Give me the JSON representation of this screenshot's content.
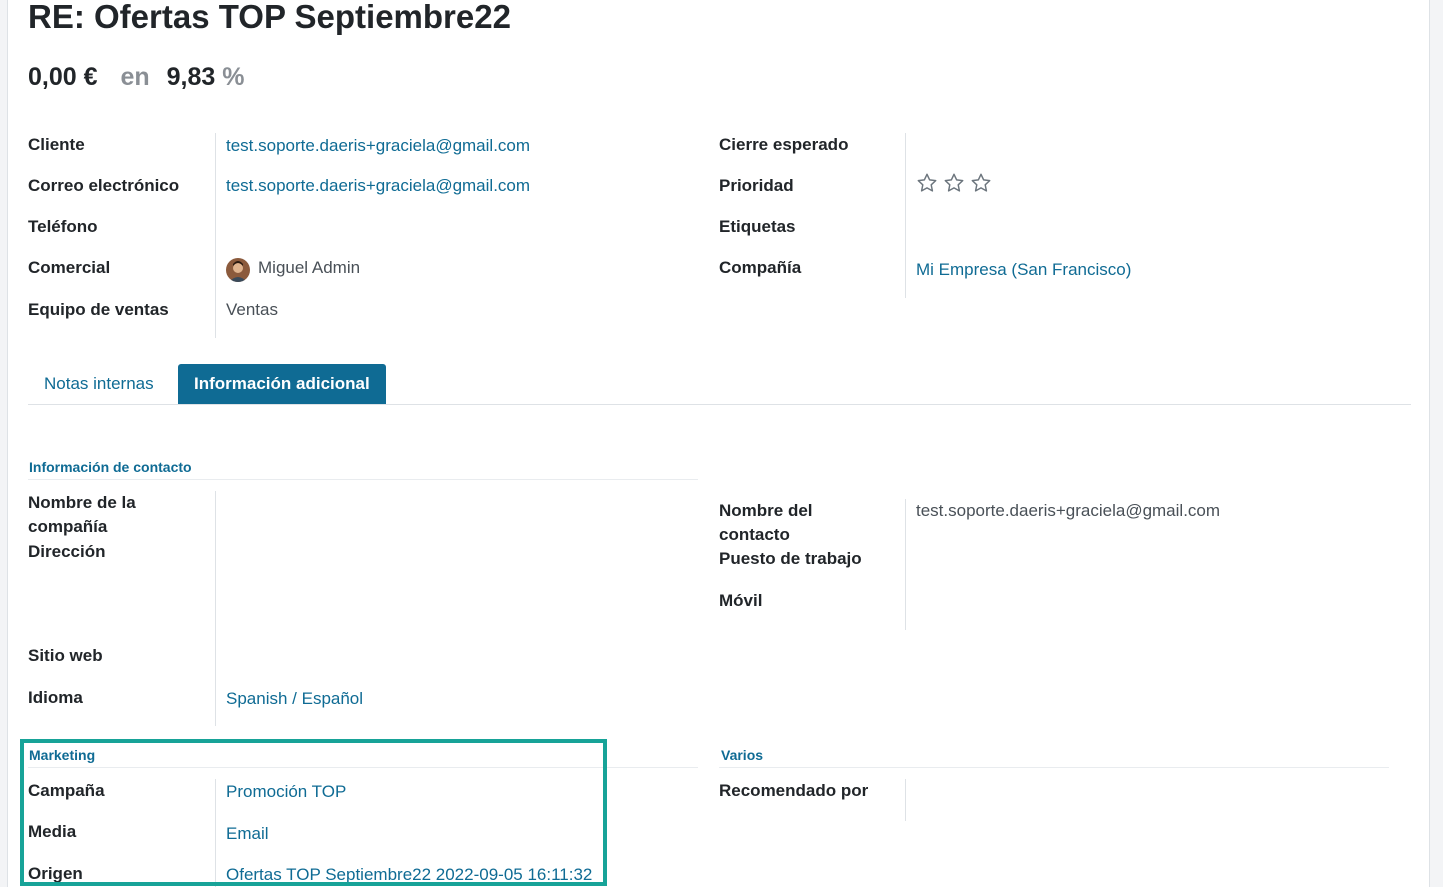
{
  "header": {
    "title": "RE: Ofertas TOP Septiembre22",
    "amount": "0,00 €",
    "amount_connector": "en",
    "probability": "9,83",
    "probability_unit": "%"
  },
  "fields_left": {
    "cliente_label": "Cliente",
    "cliente_value": "test.soporte.daeris+graciela@gmail.com",
    "correo_label": "Correo electrónico",
    "correo_value": "test.soporte.daeris+graciela@gmail.com",
    "telefono_label": "Teléfono",
    "comercial_label": "Comercial",
    "comercial_value": "Miguel Admin",
    "equipo_label": "Equipo de ventas",
    "equipo_value": "Ventas"
  },
  "fields_right": {
    "cierre_label": "Cierre esperado",
    "prioridad_label": "Prioridad",
    "prioridad_stars": 0,
    "etiquetas_label": "Etiquetas",
    "compania_label": "Compañía",
    "compania_value": "Mi Empresa (San Francisco)"
  },
  "tabs": [
    {
      "label": "Notas internas",
      "active": false
    },
    {
      "label": "Información adicional",
      "active": true
    }
  ],
  "contact_section": {
    "title": "Información de contacto",
    "company_name_label_1": "Nombre de la",
    "company_name_label_2": "compañía",
    "direccion_label": "Dirección",
    "sitio_label": "Sitio web",
    "idioma_label": "Idioma",
    "idioma_value": "Spanish / Español",
    "contact_name_label_1": "Nombre del",
    "contact_name_label_2": "contacto",
    "contact_name_value": "test.soporte.daeris+graciela@gmail.com",
    "puesto_label": "Puesto de trabajo",
    "movil_label": "Móvil"
  },
  "marketing_section": {
    "title": "Marketing",
    "campana_label": "Campaña",
    "campana_value": "Promoción TOP",
    "media_label": "Media",
    "media_value": "Email",
    "origen_label": "Origen",
    "origen_value": "Ofertas TOP Septiembre22 2022-09-05 16:11:32"
  },
  "varios_section": {
    "title": "Varios",
    "recomendado_label": "Recomendado por"
  },
  "colors": {
    "link": "#0f6b94",
    "highlight": "#17a398"
  }
}
